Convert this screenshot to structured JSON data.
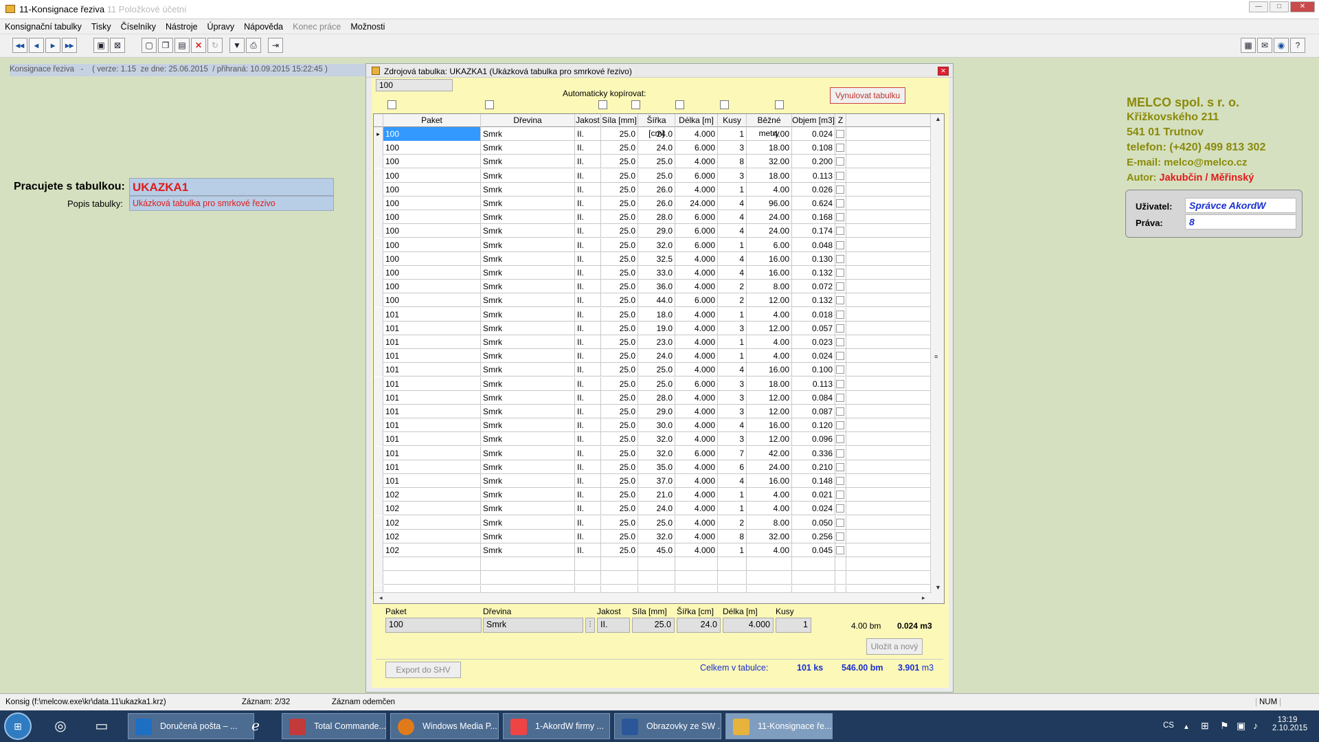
{
  "window": {
    "title": "11-Konsignace řeziva",
    "subtitle": "11 Položkové účetní"
  },
  "menu": [
    "Konsignační tabulky",
    "Tisky",
    "Číselníky",
    "Nástroje",
    "Úpravy",
    "Nápověda",
    "Konec práce",
    "Možnosti"
  ],
  "info": "Konsignace řeziva   -    ( verze: 1.15  ze dne: 25.06.2015  / přihraná: 10.09.2015 15:22:45 )",
  "work": {
    "label": "Pracujete s tabulkou:",
    "table": "UKAZKA1",
    "desc_label": "Popis tabulky:",
    "desc": "Ukázková tabulka pro smrkové řezivo"
  },
  "company": {
    "name": "MELCO spol. s r. o.",
    "street": "Křižkovského 211",
    "city": "541 01 Trutnov",
    "phone": "telefon: (+420) 499 813 302",
    "email": "E-mail: melco@melco.cz",
    "author_label": "Autor:",
    "author": "Jakubčin / Měřinský"
  },
  "user": {
    "label_user": "Uživatel:",
    "user": "Správce AkordW",
    "label_rights": "Práva:",
    "rights": "8"
  },
  "dialog": {
    "title": "Zdrojová tabulka: UKAZKA1 (Ukázková tabulka pro smrkové řezivo)",
    "source_value": "100",
    "auto_copy": "Automaticky kopírovat:",
    "reset_button": "Vynulovat tabulku",
    "columns": [
      "Paket",
      "Dřevina",
      "Jakost",
      "Síla [mm]",
      "Šířka [cm]",
      "Délka [m]",
      "Kusy",
      "Běžné metry",
      "Objem [m3]",
      "Z"
    ],
    "rows": [
      [
        "100",
        "Smrk",
        "II.",
        "25.0",
        "24.0",
        "4.000",
        "1",
        "4.00",
        "0.024"
      ],
      [
        "100",
        "Smrk",
        "II.",
        "25.0",
        "24.0",
        "6.000",
        "3",
        "18.00",
        "0.108"
      ],
      [
        "100",
        "Smrk",
        "II.",
        "25.0",
        "25.0",
        "4.000",
        "8",
        "32.00",
        "0.200"
      ],
      [
        "100",
        "Smrk",
        "II.",
        "25.0",
        "25.0",
        "6.000",
        "3",
        "18.00",
        "0.113"
      ],
      [
        "100",
        "Smrk",
        "II.",
        "25.0",
        "26.0",
        "4.000",
        "1",
        "4.00",
        "0.026"
      ],
      [
        "100",
        "Smrk",
        "II.",
        "25.0",
        "26.0",
        "24.000",
        "4",
        "96.00",
        "0.624"
      ],
      [
        "100",
        "Smrk",
        "II.",
        "25.0",
        "28.0",
        "6.000",
        "4",
        "24.00",
        "0.168"
      ],
      [
        "100",
        "Smrk",
        "II.",
        "25.0",
        "29.0",
        "6.000",
        "4",
        "24.00",
        "0.174"
      ],
      [
        "100",
        "Smrk",
        "II.",
        "25.0",
        "32.0",
        "6.000",
        "1",
        "6.00",
        "0.048"
      ],
      [
        "100",
        "Smrk",
        "II.",
        "25.0",
        "32.5",
        "4.000",
        "4",
        "16.00",
        "0.130"
      ],
      [
        "100",
        "Smrk",
        "II.",
        "25.0",
        "33.0",
        "4.000",
        "4",
        "16.00",
        "0.132"
      ],
      [
        "100",
        "Smrk",
        "II.",
        "25.0",
        "36.0",
        "4.000",
        "2",
        "8.00",
        "0.072"
      ],
      [
        "100",
        "Smrk",
        "II.",
        "25.0",
        "44.0",
        "6.000",
        "2",
        "12.00",
        "0.132"
      ],
      [
        "101",
        "Smrk",
        "II.",
        "25.0",
        "18.0",
        "4.000",
        "1",
        "4.00",
        "0.018"
      ],
      [
        "101",
        "Smrk",
        "II.",
        "25.0",
        "19.0",
        "4.000",
        "3",
        "12.00",
        "0.057"
      ],
      [
        "101",
        "Smrk",
        "II.",
        "25.0",
        "23.0",
        "4.000",
        "1",
        "4.00",
        "0.023"
      ],
      [
        "101",
        "Smrk",
        "II.",
        "25.0",
        "24.0",
        "4.000",
        "1",
        "4.00",
        "0.024"
      ],
      [
        "101",
        "Smrk",
        "II.",
        "25.0",
        "25.0",
        "4.000",
        "4",
        "16.00",
        "0.100"
      ],
      [
        "101",
        "Smrk",
        "II.",
        "25.0",
        "25.0",
        "6.000",
        "3",
        "18.00",
        "0.113"
      ],
      [
        "101",
        "Smrk",
        "II.",
        "25.0",
        "28.0",
        "4.000",
        "3",
        "12.00",
        "0.084"
      ],
      [
        "101",
        "Smrk",
        "II.",
        "25.0",
        "29.0",
        "4.000",
        "3",
        "12.00",
        "0.087"
      ],
      [
        "101",
        "Smrk",
        "II.",
        "25.0",
        "30.0",
        "4.000",
        "4",
        "16.00",
        "0.120"
      ],
      [
        "101",
        "Smrk",
        "II.",
        "25.0",
        "32.0",
        "4.000",
        "3",
        "12.00",
        "0.096"
      ],
      [
        "101",
        "Smrk",
        "II.",
        "25.0",
        "32.0",
        "6.000",
        "7",
        "42.00",
        "0.336"
      ],
      [
        "101",
        "Smrk",
        "II.",
        "25.0",
        "35.0",
        "4.000",
        "6",
        "24.00",
        "0.210"
      ],
      [
        "101",
        "Smrk",
        "II.",
        "25.0",
        "37.0",
        "4.000",
        "4",
        "16.00",
        "0.148"
      ],
      [
        "102",
        "Smrk",
        "II.",
        "25.0",
        "21.0",
        "4.000",
        "1",
        "4.00",
        "0.021"
      ],
      [
        "102",
        "Smrk",
        "II.",
        "25.0",
        "24.0",
        "4.000",
        "1",
        "4.00",
        "0.024"
      ],
      [
        "102",
        "Smrk",
        "II.",
        "25.0",
        "25.0",
        "4.000",
        "2",
        "8.00",
        "0.050"
      ],
      [
        "102",
        "Smrk",
        "II.",
        "25.0",
        "32.0",
        "4.000",
        "8",
        "32.00",
        "0.256"
      ],
      [
        "102",
        "Smrk",
        "II.",
        "25.0",
        "45.0",
        "4.000",
        "1",
        "4.00",
        "0.045"
      ]
    ],
    "edit": {
      "labels": [
        "Paket",
        "Dřevina",
        "Jakost",
        "Síla [mm]",
        "Šířka [cm]",
        "Délka [m]",
        "Kusy"
      ],
      "paket": "100",
      "drevina": "Smrk",
      "jakost": "II.",
      "sila": "25.0",
      "sirka": "24.0",
      "delka": "4.000",
      "kusy": "1",
      "bm": "4.00 bm",
      "objem": "0.024 m3"
    },
    "save_button": "Uložit a nový",
    "export_button": "Export do SHV",
    "total_label": "Celkem v tabulce:",
    "total_ks": "101 ks",
    "total_bm": "546.00 bm",
    "total_m3": "3.901",
    "total_m3_unit": "m3"
  },
  "status": {
    "path": "Konsig (f:\\melcow.exe\\kr\\data.11\\ukazka1.krz)",
    "record": "Záznam: 2/32",
    "state": "Záznam odemčen",
    "num": "NUM"
  },
  "taskbar": {
    "items": [
      "Doručená pošta – ...",
      "Total Commande...",
      "Windows Media P...",
      "1-AkordW firmy ...",
      "Obrazovky ze SW ...",
      "11-Konsignace ře..."
    ],
    "lang": "CS",
    "time": "13:19",
    "date": "2.10.2015"
  }
}
